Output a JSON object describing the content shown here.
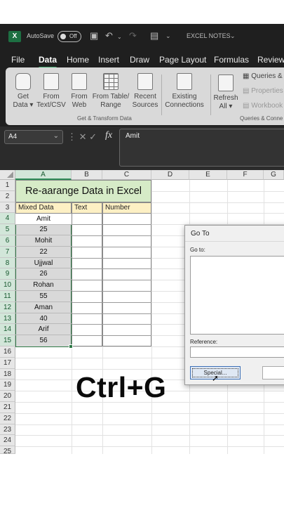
{
  "titlebar": {
    "logo": "X",
    "autosave_label": "AutoSave",
    "toggle_state": "Off",
    "document_title": "EXCEL NOTES"
  },
  "menu": [
    "File",
    "Data",
    "Home",
    "Insert",
    "Draw",
    "Page Layout",
    "Formulas",
    "Review"
  ],
  "ribbon": {
    "buttons": [
      {
        "line1": "Get",
        "line2": "Data ▾"
      },
      {
        "line1": "From",
        "line2": "Text/CSV"
      },
      {
        "line1": "From",
        "line2": "Web"
      },
      {
        "line1": "From Table/",
        "line2": "Range"
      },
      {
        "line1": "Recent",
        "line2": "Sources"
      },
      {
        "line1": "Existing",
        "line2": "Connections"
      },
      {
        "line1": "Refresh",
        "line2": "All ▾"
      }
    ],
    "group1_label": "Get & Transform Data",
    "group2_label": "Queries & Conne",
    "small_items": [
      "Queries &",
      "Properties",
      "Workbook"
    ]
  },
  "formula_bar": {
    "name_box": "A4",
    "fx": "fx",
    "value": "Amit"
  },
  "sheet": {
    "columns": [
      "A",
      "B",
      "C",
      "D",
      "E",
      "F",
      "G"
    ],
    "rows": [
      "1",
      "2",
      "3",
      "4",
      "5",
      "6",
      "7",
      "8",
      "9",
      "10",
      "11",
      "12",
      "13",
      "14",
      "15",
      "16",
      "17",
      "18",
      "19",
      "20",
      "21",
      "22",
      "23",
      "24",
      "25"
    ],
    "title": "Re-aarange Data in Excel",
    "headers": [
      "Mixed Data",
      "Text",
      "Number"
    ],
    "values": [
      "Amit",
      "25",
      "Mohit",
      "22",
      "Ujjwal",
      "26",
      "Rohan",
      "55",
      "Aman",
      "40",
      "Arif",
      "56"
    ]
  },
  "dialog": {
    "title": "Go To",
    "goto_label": "Go to:",
    "reference_label": "Reference:",
    "special_button": "Special..."
  },
  "overlay_text": "Ctrl+G"
}
